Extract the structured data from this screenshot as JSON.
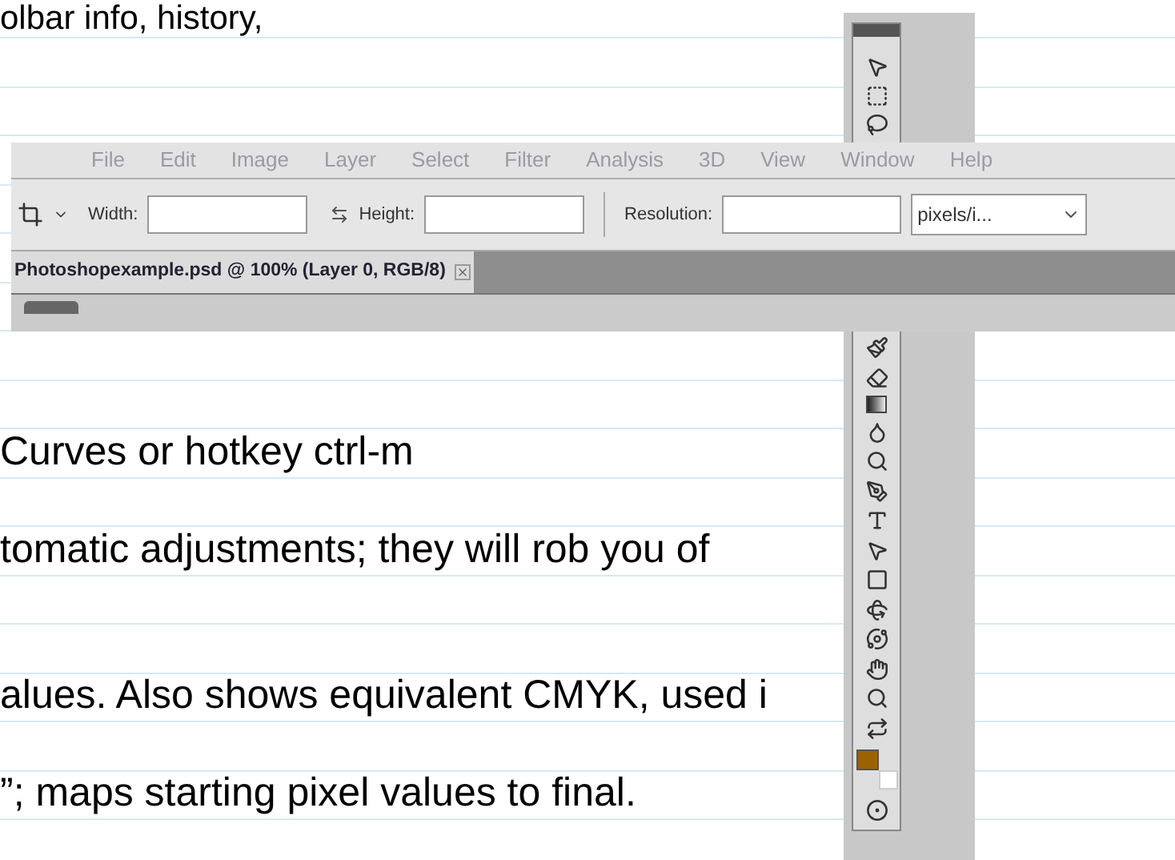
{
  "notes": [
    {
      "text": "olbar info, history,"
    },
    {
      "text": "Curves  or hotkey ctrl-m"
    },
    {
      "text": "tomatic adjustments; they will rob you of"
    },
    {
      "text": "alues. Also shows equivalent CMYK, used i"
    },
    {
      "text": "”; maps starting pixel values to final."
    }
  ],
  "screenshot": {
    "menu": [
      "File",
      "Edit",
      "Image",
      "Layer",
      "Select",
      "Filter",
      "Analysis",
      "3D",
      "View",
      "Window",
      "Help"
    ],
    "options": {
      "width_label": "Width:",
      "height_label": "Height:",
      "resolution_label": "Resolution:",
      "unit": "pixels/i..."
    },
    "document_tab": {
      "title": "Photoshopexample.psd @ 100% (Layer 0, RGB/8)"
    }
  },
  "toolbox": {
    "swatches": [
      {
        "color": "#9c6100"
      },
      {
        "color": "#ffffff"
      }
    ]
  }
}
